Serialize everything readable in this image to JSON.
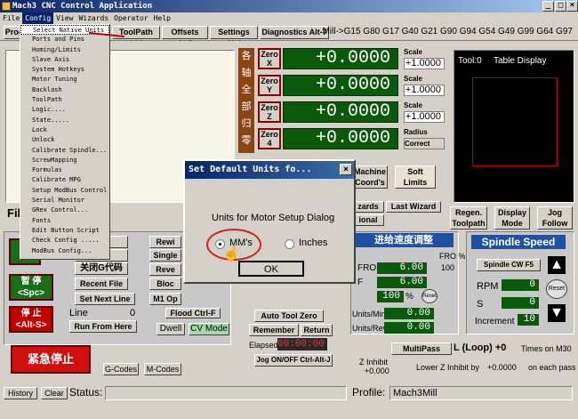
{
  "window": {
    "title": "Mach3 CNC Control Application",
    "min": "_",
    "max": "□",
    "close": "×"
  },
  "menu": [
    "File",
    "Config",
    "View",
    "Wizards",
    "Operator",
    "Help"
  ],
  "tabs": {
    "program_run_partial": "Prog",
    "toolpath": "ToolPath Alt4",
    "offsets": "Offsets Alt5",
    "settings": "Settings Alt6",
    "diagnostics": "Diagnostics Alt-7"
  },
  "gcode_modal": "Mill->G15  G80 G17 G40 G21 G90 G94 G54 G49 G99 G64 G97",
  "config_menu": [
    "Select Native Units",
    "Ports and Pins",
    "Homing/Limits",
    "Slave Axis",
    "System Hotkeys",
    "Motor Tuning",
    "Backlash",
    "ToolPath",
    "Logic....",
    "State.....",
    "Lock",
    "Unlock",
    "Calibrate Spindle...",
    "ScrewMapping",
    "Formulas",
    "Calibrate MPG",
    "Setup ModBus Control",
    "Serial Monitor",
    "GRex Control...",
    "Fonts",
    "Edit Button Script",
    "Check Config .....",
    "ModBus Config..."
  ],
  "axis_labels": [
    "各",
    "轴",
    "全",
    "部",
    "归",
    "零"
  ],
  "axes": [
    {
      "zero_line1": "Zero",
      "zero_line2": "X",
      "value": "+0.0000",
      "scale_label": "Scale",
      "scale": "+1.0000"
    },
    {
      "zero_line1": "Zero",
      "zero_line2": "Y",
      "value": "+0.0000",
      "scale_label": "Scale",
      "scale": "+1.0000"
    },
    {
      "zero_line1": "Zero",
      "zero_line2": "Z",
      "value": "+0.0000",
      "scale_label": "Scale",
      "scale": "+1.0000"
    },
    {
      "zero_line1": "Zero",
      "zero_line2": "4",
      "value": "+0.0000",
      "scale_label": "Radius",
      "scale": "Correct"
    }
  ],
  "machine_coords": [
    "Machine",
    "Coord's"
  ],
  "soft_limits": [
    "Soft",
    "Limits"
  ],
  "tool_display": {
    "tool": "Tool:0",
    "title": "Table Display"
  },
  "wizards": {
    "partial": "zards",
    "last": "Last Wizard",
    "optional": "ional"
  },
  "regen": [
    "Regen.",
    "Toolpath"
  ],
  "display_mode": [
    "Display",
    "Mode"
  ],
  "jog_follow": [
    "Jog",
    "Follow"
  ],
  "file_label": "Fil",
  "left_buttons": {
    "cycle_partial": "开",
    "pause": [
      "暂 停",
      "<Spc>"
    ],
    "stop": [
      "停 止",
      "<Alt-S>"
    ],
    "estop": "紧急停止",
    "code_1": "代码",
    "code_2": "代码",
    "close_g": "关闭G代码",
    "recent": "Recent File",
    "next_line": "Set Next Line",
    "line_label": "Line",
    "line_value": "0",
    "run_from_here": "Run From Here",
    "rewind": "Rewi",
    "single": "Single",
    "reverse": "Reve",
    "block": "Bloc",
    "m1": "M1 Op",
    "flood": "Flood Ctrl-F",
    "dwell": "Dwell",
    "cv_mode": "CV Mode"
  },
  "bottom_tabs": {
    "gcodes": "G-Codes",
    "mcodes": "M-Codes"
  },
  "dialog": {
    "title": "Set Default Units fo...",
    "close": "×",
    "prompt": "Units for Motor Setup Dialog",
    "opt_mm": "MM's",
    "opt_in": "Inches",
    "ok": "OK",
    "selected": "mm"
  },
  "feed": {
    "header": "进给速度调整",
    "fro_label": "FRO",
    "fro_value": "6.00",
    "fro_pct_label": "FRO %",
    "fro_pct": "100",
    "f_label": "F",
    "f_value": "6.00",
    "pct_value": "100",
    "pct_sign": "%",
    "reset": "Reset",
    "units_min_label": "Units/Min",
    "units_min": "0.00",
    "units_rev_label": "Units/Rev",
    "units_rev": "0.00"
  },
  "spindle": {
    "header": "Spindle Speed",
    "cw": "Spindle CW F5",
    "rpm_label": "RPM",
    "rpm": "0",
    "s_label": "S",
    "s": "0",
    "increment_label": "Increment",
    "increment": "10",
    "reset": "Reset"
  },
  "tool_controls": {
    "auto_zero": "Auto Tool Zero",
    "remember": "Remember",
    "return": "Return",
    "elapsed_label": "Elapsed",
    "elapsed": "00:00:00",
    "jog_toggle": "Jog ON/OFF Ctrl-Alt-J"
  },
  "multipass": {
    "label": "MultiPass",
    "loop": "L (Loop) +0",
    "times": "Times on M30"
  },
  "inhibit": {
    "label": "Z Inhibit",
    "value": "+0.000",
    "lower_text": "Lower Z Inhibit by",
    "lower_value": "+0.0000",
    "on_each": "on each pass"
  },
  "status": {
    "history": "History",
    "clear": "Clear",
    "status_label": "Status:",
    "profile_label": "Profile:",
    "profile": "Mach3Mill"
  }
}
